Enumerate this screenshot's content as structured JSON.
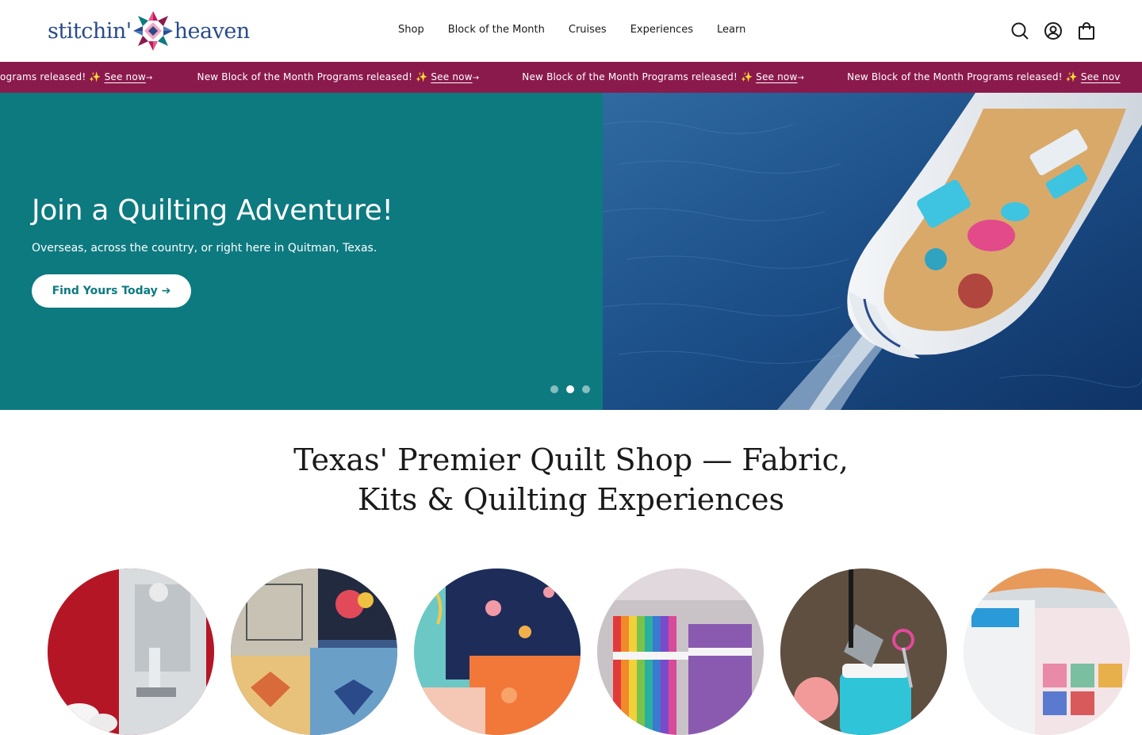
{
  "brand": {
    "logo_left": "stitchin'",
    "logo_right": "heaven"
  },
  "nav": [
    "Shop",
    "Block of the Month",
    "Cruises",
    "Experiences",
    "Learn"
  ],
  "header_icons": [
    "search-icon",
    "account-icon",
    "cart-icon"
  ],
  "ticker": {
    "message": "New Block of the Month Programs released! ✨",
    "link": "See now",
    "arrow": "→",
    "first_fragment": "ograms released! ✨",
    "last_link_fragment": "See nov"
  },
  "hero": {
    "title": "Join a Quilting Adventure!",
    "subtitle": "Overseas, across the country, or right here in Quitman, Texas.",
    "cta": "Find Yours Today ➔",
    "slides": 3,
    "active_slide": 2
  },
  "headline": {
    "line1": "Texas' Premier Quilt Shop — Fabric,",
    "line2": "Kits & Quilting Experiences"
  },
  "categories": [
    "sewing-machine-image",
    "quilt-patterns-image",
    "fabric-image",
    "fabric-bundles-image",
    "notions-image",
    "books-image"
  ],
  "colors": {
    "teal": "#0d7a80",
    "maroon": "#8b1a4c",
    "navy": "#2a4a8a"
  }
}
